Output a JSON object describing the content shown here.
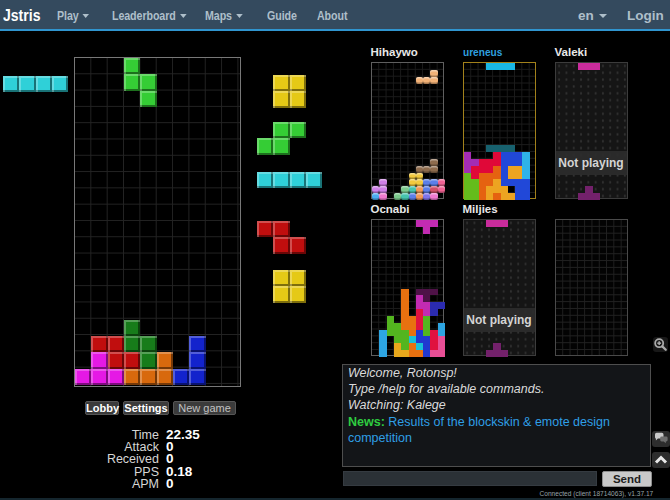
{
  "navbar": {
    "brand": "Jstris",
    "items": [
      {
        "label": "Play",
        "caret": true
      },
      {
        "label": "Leaderboard",
        "caret": true
      },
      {
        "label": "Maps",
        "caret": true
      },
      {
        "label": "Guide",
        "caret": false
      },
      {
        "label": "About",
        "caret": false
      }
    ],
    "right_items": [
      {
        "label": "en",
        "caret": true
      },
      {
        "label": "Login",
        "caret": false
      }
    ]
  },
  "palettes": {
    "main": {
      "C": "#2fd0d8",
      "Y": "#e5c916",
      "G": "#35cd35",
      "G2": "#177c1a",
      "R": "#c00e0e",
      "M": "#e519e5",
      "O": "#d8690d",
      "B": "#1323cc"
    },
    "hi": {
      "br": "#8d6b4d",
      "ye": "#f2c93e",
      "pu": "#cf7fe8",
      "bl": "#5b7fe8",
      "ro": "#ef6292",
      "gr": "#7bc98c",
      "te": "#46c4ae",
      "or": "#f29a57",
      "cr": "#d04f67",
      "cy": "#4bacf0",
      "pi": "#f07ad0",
      "vi": "#7f74ea",
      "pe": "#f2b277"
    },
    "ur": {
      "gh": "#17616e",
      "pu": "#a42cb4",
      "re": "#e00838",
      "bu": "#2148d8",
      "lb": "#2fb3e8",
      "am": "#eda421",
      "or": "#e56210",
      "gr": "#64bc1c",
      "cy": "#19b8e6"
    },
    "oc": {
      "or": "#e87110",
      "ma": "#c22bb2",
      "nv": "#2b2bb0",
      "dp": "#4e1247",
      "cr": "#e01240",
      "gr": "#53b51f",
      "cy": "#2da5e2",
      "cy2": "#19c0d8",
      "bu": "#2038d0",
      "am": "#e8a81c",
      "pi": "#e84f96"
    },
    "np": {
      "top": "#c92c9c",
      "bot": "#73216b"
    }
  },
  "hold": {
    "piece": "I",
    "cells": [
      [
        0,
        0,
        "C"
      ],
      [
        1,
        0,
        "C"
      ],
      [
        2,
        0,
        "C"
      ],
      [
        3,
        0,
        "C"
      ]
    ]
  },
  "board": {
    "falling": [
      [
        3,
        0,
        "G"
      ],
      [
        3,
        1,
        "G"
      ],
      [
        4,
        1,
        "G"
      ],
      [
        4,
        2,
        "G"
      ]
    ],
    "stack": [
      [
        3,
        16,
        "G2"
      ],
      [
        1,
        17,
        "R"
      ],
      [
        2,
        17,
        "R"
      ],
      [
        3,
        17,
        "G2"
      ],
      [
        4,
        17,
        "G2"
      ],
      [
        7,
        17,
        "B"
      ],
      [
        1,
        18,
        "M"
      ],
      [
        2,
        18,
        "R"
      ],
      [
        3,
        18,
        "R"
      ],
      [
        4,
        18,
        "G2"
      ],
      [
        5,
        18,
        "O"
      ],
      [
        7,
        18,
        "B"
      ],
      [
        0,
        19,
        "M"
      ],
      [
        1,
        19,
        "M"
      ],
      [
        2,
        19,
        "M"
      ],
      [
        3,
        19,
        "O"
      ],
      [
        4,
        19,
        "O"
      ],
      [
        5,
        19,
        "O"
      ],
      [
        6,
        19,
        "B"
      ],
      [
        7,
        19,
        "B"
      ]
    ]
  },
  "queue": [
    {
      "type": "O",
      "color": "Y",
      "cells": [
        [
          1,
          0
        ],
        [
          2,
          0
        ],
        [
          1,
          1
        ],
        [
          2,
          1
        ]
      ]
    },
    {
      "type": "S",
      "color": "G",
      "cells": [
        [
          1,
          0
        ],
        [
          2,
          0
        ],
        [
          0,
          1
        ],
        [
          1,
          1
        ]
      ]
    },
    {
      "type": "I",
      "color": "C",
      "cells": [
        [
          0,
          0
        ],
        [
          1,
          0
        ],
        [
          2,
          0
        ],
        [
          3,
          0
        ]
      ]
    },
    {
      "type": "Z",
      "color": "R",
      "cells": [
        [
          0,
          0
        ],
        [
          1,
          0
        ],
        [
          1,
          1
        ],
        [
          2,
          1
        ]
      ]
    },
    {
      "type": "O",
      "color": "Y",
      "cells": [
        [
          1,
          0
        ],
        [
          2,
          0
        ],
        [
          1,
          1
        ],
        [
          2,
          1
        ]
      ]
    }
  ],
  "buttons": [
    {
      "label": "Lobby"
    },
    {
      "label": "Settings"
    },
    {
      "label": "New game"
    }
  ],
  "stats": [
    {
      "label": "Time",
      "value": "22.35"
    },
    {
      "label": "Attack",
      "value": "0"
    },
    {
      "label": "Received",
      "value": "0"
    },
    {
      "label": "PPS",
      "value": "0.18"
    },
    {
      "label": "APM",
      "value": "0"
    }
  ],
  "players": [
    {
      "name": "Hihaywo",
      "state": "playing",
      "skin": "glossy",
      "palette": "hi",
      "falling": [
        [
          8,
          1,
          "pe"
        ],
        [
          6,
          2,
          "pe"
        ],
        [
          7,
          2,
          "pe"
        ],
        [
          8,
          2,
          "pe"
        ]
      ],
      "cells": [
        [
          8,
          14,
          "br"
        ],
        [
          6,
          15,
          "br"
        ],
        [
          7,
          15,
          "br"
        ],
        [
          8,
          15,
          "br"
        ],
        [
          5,
          16,
          "ye"
        ],
        [
          6,
          16,
          "ye"
        ],
        [
          1,
          17,
          "pu"
        ],
        [
          5,
          17,
          "ye"
        ],
        [
          6,
          17,
          "ye"
        ],
        [
          7,
          17,
          "bl"
        ],
        [
          8,
          17,
          "bl"
        ],
        [
          9,
          17,
          "ro"
        ],
        [
          0,
          18,
          "pu"
        ],
        [
          1,
          18,
          "pu"
        ],
        [
          4,
          18,
          "gr"
        ],
        [
          5,
          18,
          "te"
        ],
        [
          6,
          18,
          "or"
        ],
        [
          7,
          18,
          "bl"
        ],
        [
          8,
          18,
          "cr"
        ],
        [
          9,
          18,
          "ro"
        ],
        [
          0,
          19,
          "cy"
        ],
        [
          1,
          19,
          "pi"
        ],
        [
          3,
          19,
          "gr"
        ],
        [
          4,
          19,
          "te"
        ],
        [
          5,
          19,
          "bl"
        ],
        [
          6,
          19,
          "or"
        ],
        [
          7,
          19,
          "vi"
        ],
        [
          8,
          19,
          "pi"
        ]
      ]
    },
    {
      "name": "ureneus",
      "state": "watched",
      "skin": "flat",
      "palette": "ur",
      "falling": [
        [
          3,
          0,
          "cy"
        ],
        [
          4,
          0,
          "cy"
        ],
        [
          5,
          0,
          "cy"
        ],
        [
          6,
          0,
          "cy"
        ]
      ],
      "ghost": [
        [
          3,
          12,
          "gh"
        ],
        [
          4,
          12,
          "gh"
        ],
        [
          5,
          12,
          "gh"
        ],
        [
          6,
          12,
          "gh"
        ]
      ],
      "cells": [
        [
          0,
          13,
          "pu"
        ],
        [
          4,
          13,
          "re"
        ],
        [
          5,
          13,
          "bu"
        ],
        [
          6,
          13,
          "bu"
        ],
        [
          7,
          13,
          "bu"
        ],
        [
          8,
          13,
          "lb"
        ],
        [
          0,
          14,
          "pu"
        ],
        [
          1,
          14,
          "pu"
        ],
        [
          2,
          14,
          "re"
        ],
        [
          3,
          14,
          "re"
        ],
        [
          4,
          14,
          "re"
        ],
        [
          5,
          14,
          "bu"
        ],
        [
          6,
          14,
          "bu"
        ],
        [
          7,
          14,
          "bu"
        ],
        [
          8,
          14,
          "lb"
        ],
        [
          0,
          15,
          "pu"
        ],
        [
          1,
          15,
          "re"
        ],
        [
          2,
          15,
          "re"
        ],
        [
          3,
          15,
          "re"
        ],
        [
          4,
          15,
          "or"
        ],
        [
          5,
          15,
          "bu"
        ],
        [
          6,
          15,
          "am"
        ],
        [
          7,
          15,
          "am"
        ],
        [
          8,
          15,
          "lb"
        ],
        [
          0,
          16,
          "gr"
        ],
        [
          1,
          16,
          "re"
        ],
        [
          2,
          16,
          "or"
        ],
        [
          3,
          16,
          "or"
        ],
        [
          4,
          16,
          "or"
        ],
        [
          5,
          16,
          "bu"
        ],
        [
          6,
          16,
          "am"
        ],
        [
          7,
          16,
          "am"
        ],
        [
          8,
          16,
          "lb"
        ],
        [
          0,
          17,
          "gr"
        ],
        [
          1,
          17,
          "gr"
        ],
        [
          2,
          17,
          "or"
        ],
        [
          3,
          17,
          "or"
        ],
        [
          4,
          17,
          "am"
        ],
        [
          5,
          17,
          "bu"
        ],
        [
          6,
          17,
          "bu"
        ],
        [
          7,
          17,
          "bu"
        ],
        [
          8,
          17,
          "bu"
        ],
        [
          0,
          18,
          "gr"
        ],
        [
          1,
          18,
          "gr"
        ],
        [
          2,
          18,
          "or"
        ],
        [
          3,
          18,
          "am"
        ],
        [
          4,
          18,
          "am"
        ],
        [
          5,
          18,
          "am"
        ],
        [
          7,
          18,
          "bu"
        ],
        [
          8,
          18,
          "bu"
        ],
        [
          0,
          19,
          "gr"
        ],
        [
          1,
          19,
          "gr"
        ],
        [
          2,
          19,
          "or"
        ],
        [
          3,
          19,
          "am"
        ],
        [
          4,
          19,
          "or"
        ],
        [
          5,
          19,
          "am"
        ],
        [
          6,
          19,
          "am"
        ],
        [
          7,
          19,
          "bu"
        ],
        [
          8,
          19,
          "bu"
        ]
      ]
    },
    {
      "name": "Valeki",
      "state": "not_playing",
      "skin": "flat",
      "palette": "np",
      "overlay": "Not playing",
      "falling": [
        [
          3,
          0,
          "top"
        ],
        [
          4,
          0,
          "top"
        ],
        [
          5,
          0,
          "top"
        ]
      ],
      "cells": [
        [
          4,
          18,
          "bot"
        ],
        [
          3,
          19,
          "bot"
        ],
        [
          4,
          19,
          "bot"
        ],
        [
          5,
          19,
          "bot"
        ]
      ]
    },
    {
      "name": "Ocnabi",
      "state": "playing",
      "skin": "flat",
      "palette": "oc",
      "falling": [
        [
          6,
          0,
          "ma"
        ],
        [
          7,
          0,
          "ma"
        ],
        [
          8,
          0,
          "ma"
        ],
        [
          7,
          1,
          "ma"
        ]
      ],
      "ghost": [
        [
          6,
          10,
          "dp"
        ],
        [
          7,
          10,
          "dp"
        ],
        [
          8,
          10,
          "dp"
        ],
        [
          7,
          11,
          "dp"
        ]
      ],
      "cells": [
        [
          4,
          10,
          "or"
        ],
        [
          4,
          11,
          "or"
        ],
        [
          6,
          11,
          "ma"
        ],
        [
          4,
          12,
          "or"
        ],
        [
          6,
          12,
          "ma"
        ],
        [
          7,
          12,
          "ma"
        ],
        [
          8,
          12,
          "nv"
        ],
        [
          9,
          12,
          "nv"
        ],
        [
          4,
          13,
          "or"
        ],
        [
          6,
          13,
          "cr"
        ],
        [
          7,
          13,
          "ma"
        ],
        [
          8,
          13,
          "nv"
        ],
        [
          2,
          14,
          "gr"
        ],
        [
          4,
          14,
          "or"
        ],
        [
          5,
          14,
          "or"
        ],
        [
          6,
          14,
          "cr"
        ],
        [
          7,
          14,
          "gr"
        ],
        [
          2,
          15,
          "gr"
        ],
        [
          3,
          15,
          "gr"
        ],
        [
          4,
          15,
          "or"
        ],
        [
          5,
          15,
          "or"
        ],
        [
          6,
          15,
          "cr"
        ],
        [
          7,
          15,
          "gr"
        ],
        [
          9,
          15,
          "cy"
        ],
        [
          1,
          16,
          "cy"
        ],
        [
          2,
          16,
          "gr"
        ],
        [
          3,
          16,
          "gr"
        ],
        [
          4,
          16,
          "gr"
        ],
        [
          5,
          16,
          "or"
        ],
        [
          6,
          16,
          "bu"
        ],
        [
          7,
          16,
          "gr"
        ],
        [
          8,
          16,
          "cr"
        ],
        [
          9,
          16,
          "cy"
        ],
        [
          1,
          17,
          "cy"
        ],
        [
          3,
          17,
          "gr"
        ],
        [
          4,
          17,
          "gr"
        ],
        [
          5,
          17,
          "cy2"
        ],
        [
          6,
          17,
          "bu"
        ],
        [
          7,
          17,
          "bu"
        ],
        [
          8,
          17,
          "cr"
        ],
        [
          9,
          17,
          "pi"
        ],
        [
          1,
          18,
          "cy"
        ],
        [
          3,
          18,
          "am"
        ],
        [
          4,
          18,
          "gr"
        ],
        [
          5,
          18,
          "or"
        ],
        [
          6,
          18,
          "cy2"
        ],
        [
          7,
          18,
          "bu"
        ],
        [
          8,
          18,
          "cr"
        ],
        [
          9,
          18,
          "pi"
        ],
        [
          1,
          19,
          "cy"
        ],
        [
          3,
          19,
          "am"
        ],
        [
          4,
          19,
          "am"
        ],
        [
          5,
          19,
          "or"
        ],
        [
          6,
          19,
          "or"
        ],
        [
          7,
          19,
          "bu"
        ],
        [
          8,
          19,
          "pi"
        ],
        [
          9,
          19,
          "pi"
        ]
      ]
    },
    {
      "name": "Miljies",
      "state": "not_playing",
      "skin": "flat",
      "palette": "np",
      "overlay": "Not playing",
      "falling": [
        [
          3,
          0,
          "top"
        ],
        [
          4,
          0,
          "top"
        ],
        [
          5,
          0,
          "top"
        ]
      ],
      "cells": [
        [
          4,
          18,
          "bot"
        ],
        [
          3,
          19,
          "bot"
        ],
        [
          4,
          19,
          "bot"
        ],
        [
          5,
          19,
          "bot"
        ]
      ]
    },
    {
      "name": "",
      "state": "empty",
      "skin": "flat",
      "palette": "np",
      "cells": []
    }
  ],
  "chat": {
    "lines": [
      "Welcome, Rotonsp!",
      "Type /help for available commands.",
      "Watching: Kalege"
    ],
    "news_label": "News:",
    "news_text": "Results of the blockskin & emote design competition",
    "input_value": "",
    "send_label": "Send",
    "status": "Connected (client 18714063), v1.37.17"
  },
  "icons": {
    "zoom": "magnifier-plus",
    "bubbles": "chat-bubbles",
    "collapse": "chevron-up"
  }
}
